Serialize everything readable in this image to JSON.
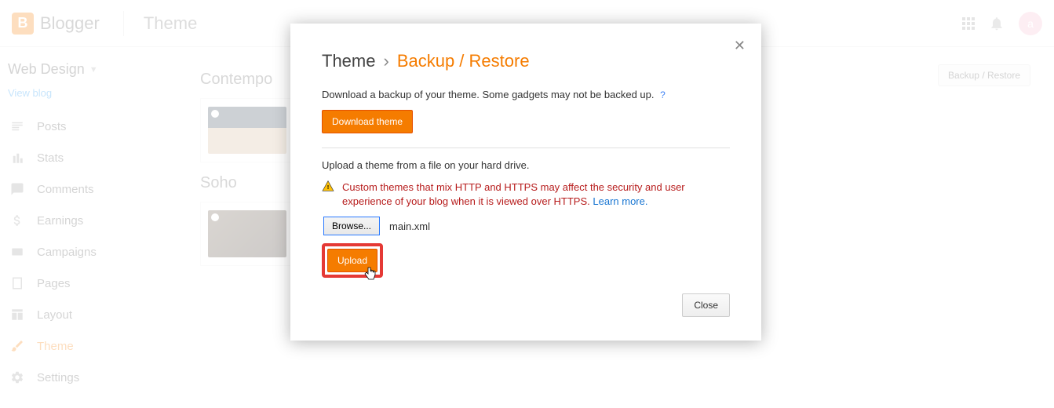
{
  "header": {
    "logo_letter": "B",
    "logo_text": "Blogger",
    "page_name": "Theme",
    "avatar_letter": "a"
  },
  "sidebar": {
    "blog_name": "Web Design",
    "view_blog": "View blog",
    "items": [
      {
        "label": "Posts"
      },
      {
        "label": "Stats"
      },
      {
        "label": "Comments"
      },
      {
        "label": "Earnings"
      },
      {
        "label": "Campaigns"
      },
      {
        "label": "Pages"
      },
      {
        "label": "Layout"
      },
      {
        "label": "Theme"
      },
      {
        "label": "Settings"
      }
    ]
  },
  "content": {
    "backup_restore_btn": "Backup / Restore",
    "section1": "Contempo",
    "section2": "Soho"
  },
  "modal": {
    "crumb_a": "Theme",
    "crumb_sep": "›",
    "crumb_b": "Backup / Restore",
    "download_help": "Download a backup of your theme. Some gadgets may not be backed up.",
    "download_btn": "Download theme",
    "upload_help": "Upload a theme from a file on your hard drive.",
    "warning": "Custom themes that mix HTTP and HTTPS may affect the security and user experience of your blog when it is viewed over HTTPS.",
    "learn_more": "Learn more.",
    "browse_btn": "Browse...",
    "filename": "main.xml",
    "upload_btn": "Upload",
    "close_btn": "Close"
  }
}
